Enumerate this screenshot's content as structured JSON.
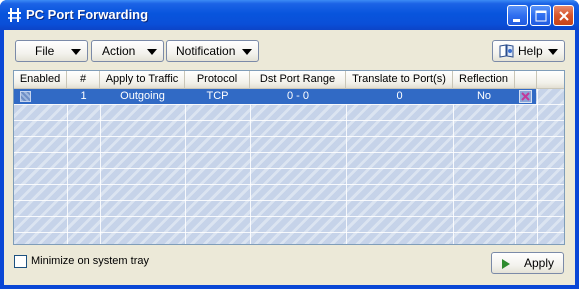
{
  "window": {
    "title": "PC Port Forwarding"
  },
  "titlebar_buttons": {
    "minimize": "minimize-icon",
    "maximize": "maximize-icon",
    "close": "close-icon"
  },
  "toolbar": {
    "file_label": "File",
    "action_label": "Action",
    "notification_label": "Notification",
    "help_label": "Help"
  },
  "table": {
    "columns": [
      "Enabled",
      "#",
      "Apply to Traffic",
      "Protocol",
      "Dst Port Range",
      "Translate to Port(s)",
      "Reflection"
    ],
    "rows": [
      {
        "enabled": "",
        "num": "1",
        "apply": "Outgoing",
        "protocol": "TCP",
        "dst": "0 - 0",
        "translate": "0",
        "reflection": "No"
      }
    ]
  },
  "footer": {
    "minimize_tray_label": "Minimize on system tray",
    "apply_label": "Apply"
  },
  "colors": {
    "selection": "#316ac5",
    "titlebar": "#0a4fd8",
    "client_bg": "#ece9d8"
  }
}
